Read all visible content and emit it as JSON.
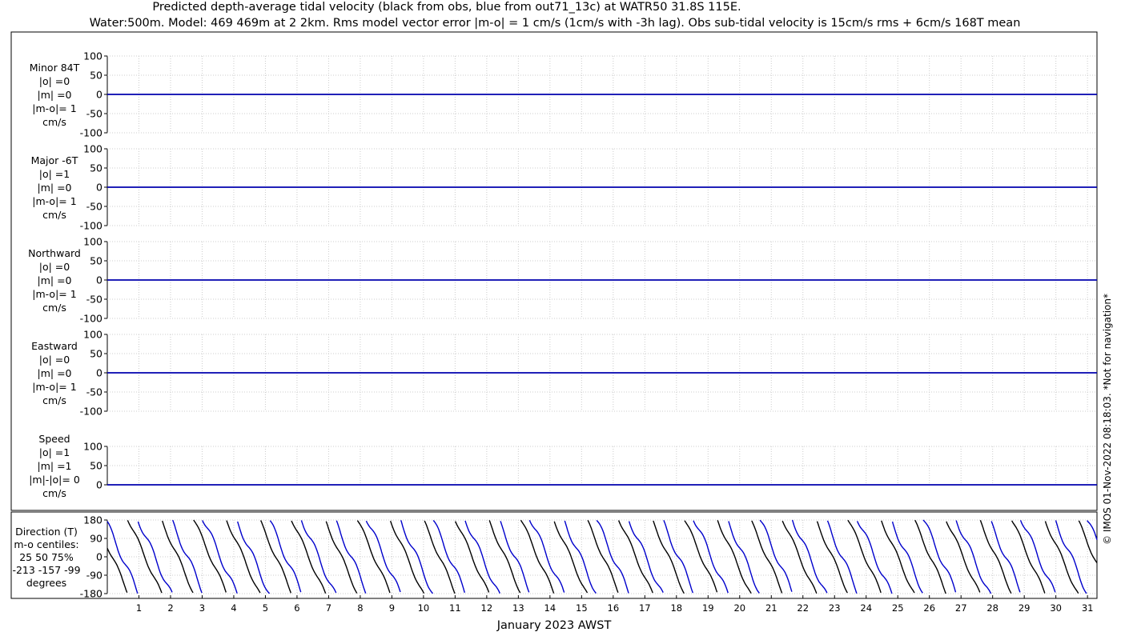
{
  "title": {
    "line1": "Predicted depth-average tidal velocity (black from obs, blue from out71_13c) at WATR50 31.8S 115E.",
    "line2": "Water:500m. Model: 469 469m at 2 2km. Rms model vector error |m-o| = 1 cm/s (1cm/s with -3h lag). Obs sub-tidal velocity is 15cm/s rms + 6cm/s 168T mean"
  },
  "watermark": "© IMOS 01-Nov-2022 08:18:03. *Not for navigation*",
  "colors": {
    "obs": "#000000",
    "model": "#0000cc",
    "grid": "#cccccc"
  },
  "chart_data": {
    "type": "line",
    "xlabel": "January 2023 AWST",
    "x_ticks": [
      "1",
      "2",
      "3",
      "4",
      "5",
      "6",
      "7",
      "8",
      "9",
      "10",
      "11",
      "12",
      "13",
      "14",
      "15",
      "16",
      "17",
      "18",
      "19",
      "20",
      "21",
      "22",
      "23",
      "24",
      "25",
      "26",
      "27",
      "28",
      "29",
      "30",
      "31"
    ],
    "xlim": [
      0,
      31.3
    ],
    "series_names": [
      "obs",
      "model"
    ],
    "panels": [
      {
        "id": "minor",
        "label_lines": [
          "Minor 84T",
          "|o| =0",
          "|m| =0",
          "|m-o|= 1",
          "cm/s"
        ],
        "ylim": [
          -100,
          100
        ],
        "yticks": [
          "100",
          "50",
          "0",
          "-50",
          "-100"
        ],
        "obs": 0,
        "model": 0
      },
      {
        "id": "major",
        "label_lines": [
          "Major -6T",
          "|o| =1",
          "|m| =0",
          "|m-o|= 1",
          "cm/s"
        ],
        "ylim": [
          -100,
          100
        ],
        "yticks": [
          "100",
          "50",
          "0",
          "-50",
          "-100"
        ],
        "obs": 0,
        "model": 0
      },
      {
        "id": "north",
        "label_lines": [
          "Northward",
          "|o| =0",
          "|m| =0",
          "|m-o|= 1",
          "cm/s"
        ],
        "ylim": [
          -100,
          100
        ],
        "yticks": [
          "100",
          "50",
          "0",
          "-50",
          "-100"
        ],
        "obs": 0,
        "model": 0
      },
      {
        "id": "east",
        "label_lines": [
          "Eastward",
          "|o| =0",
          "|m| =0",
          "|m-o|= 1",
          "cm/s"
        ],
        "ylim": [
          -100,
          100
        ],
        "yticks": [
          "100",
          "50",
          "0",
          "-50",
          "-100"
        ],
        "obs": 0,
        "model": 0
      },
      {
        "id": "speed",
        "label_lines": [
          "Speed",
          "|o| =1",
          "|m| =1",
          "|m|-|o|= 0",
          "cm/s"
        ],
        "ylim": [
          0,
          100
        ],
        "yticks": [
          "100",
          "50",
          "0"
        ],
        "obs": 0,
        "model": 0
      }
    ],
    "direction": {
      "label_lines": [
        "Direction (T)",
        "m-o centiles:",
        "25  50  75%",
        "-213 -157  -99",
        "degrees"
      ],
      "ylim": [
        -180,
        180
      ],
      "yticks": [
        "180",
        "90",
        "0",
        "-90",
        "-180"
      ],
      "period_days": 1.035,
      "obs_phase": 0.35,
      "model_phase": 0.05
    }
  }
}
